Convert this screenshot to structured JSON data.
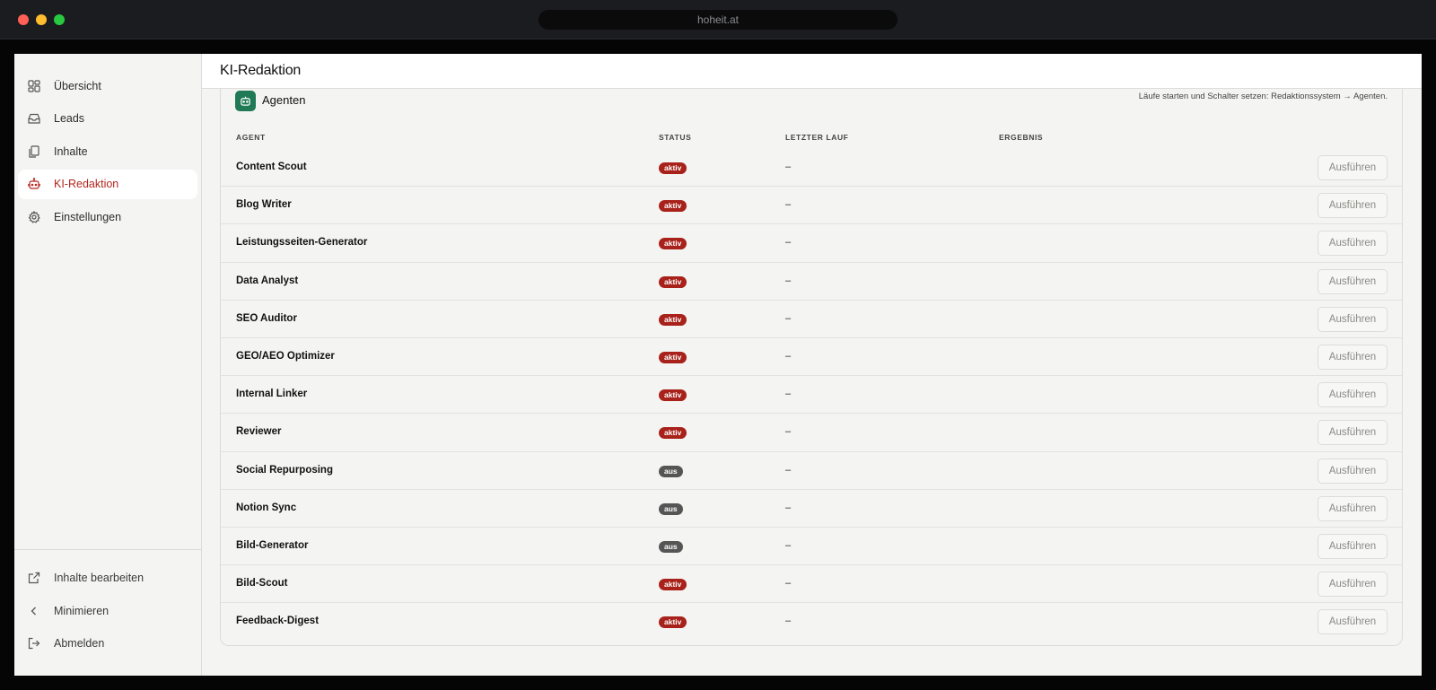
{
  "browser": {
    "url": "hoheit.at"
  },
  "sidebar": {
    "items": [
      {
        "label": "Übersicht",
        "icon": "grid-icon",
        "active": false
      },
      {
        "label": "Leads",
        "icon": "inbox-icon",
        "active": false
      },
      {
        "label": "Inhalte",
        "icon": "documents-icon",
        "active": false
      },
      {
        "label": "KI-Redaktion",
        "icon": "robot-icon",
        "active": true
      },
      {
        "label": "Einstellungen",
        "icon": "gear-icon",
        "active": false
      }
    ],
    "bottom": [
      {
        "label": "Inhalte bearbeiten",
        "icon": "external-link-icon"
      },
      {
        "label": "Minimieren",
        "icon": "chevron-left-icon"
      },
      {
        "label": "Abmelden",
        "icon": "logout-icon"
      }
    ]
  },
  "header": {
    "title": "KI-Redaktion"
  },
  "agents_card": {
    "title": "Agenten",
    "hint": "Läufe starten und Schalter setzen: Redaktionssystem → Agenten.",
    "columns": {
      "agent": "AGENT",
      "status": "STATUS",
      "last_run": "LETZTER LAUF",
      "result": "ERGEBNIS"
    },
    "run_label": "Ausführen",
    "rows": [
      {
        "name": "Content Scout",
        "status": "aktiv",
        "active": true,
        "last_run": "–",
        "result": ""
      },
      {
        "name": "Blog Writer",
        "status": "aktiv",
        "active": true,
        "last_run": "–",
        "result": ""
      },
      {
        "name": "Leistungsseiten-Generator",
        "status": "aktiv",
        "active": true,
        "last_run": "–",
        "result": ""
      },
      {
        "name": "Data Analyst",
        "status": "aktiv",
        "active": true,
        "last_run": "–",
        "result": ""
      },
      {
        "name": "SEO Auditor",
        "status": "aktiv",
        "active": true,
        "last_run": "–",
        "result": ""
      },
      {
        "name": "GEO/AEO Optimizer",
        "status": "aktiv",
        "active": true,
        "last_run": "–",
        "result": ""
      },
      {
        "name": "Internal Linker",
        "status": "aktiv",
        "active": true,
        "last_run": "–",
        "result": ""
      },
      {
        "name": "Reviewer",
        "status": "aktiv",
        "active": true,
        "last_run": "–",
        "result": ""
      },
      {
        "name": "Social Repurposing",
        "status": "aus",
        "active": false,
        "last_run": "–",
        "result": ""
      },
      {
        "name": "Notion Sync",
        "status": "aus",
        "active": false,
        "last_run": "–",
        "result": ""
      },
      {
        "name": "Bild-Generator",
        "status": "aus",
        "active": false,
        "last_run": "–",
        "result": ""
      },
      {
        "name": "Bild-Scout",
        "status": "aktiv",
        "active": true,
        "last_run": "–",
        "result": ""
      },
      {
        "name": "Feedback-Digest",
        "status": "aktiv",
        "active": true,
        "last_run": "–",
        "result": ""
      }
    ]
  },
  "colors": {
    "accent": "#b3261e",
    "status_active": "#a8211a",
    "status_inactive": "#555555",
    "agent_icon_bg": "#1f7a55"
  }
}
